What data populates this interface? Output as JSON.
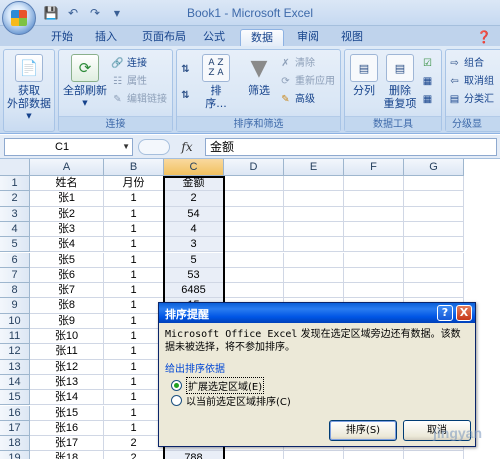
{
  "window": {
    "title": "Book1 - Microsoft Excel"
  },
  "qat": {
    "icons": [
      "save-icon",
      "undo-icon",
      "redo-icon"
    ]
  },
  "tabs": [
    {
      "label": "开始",
      "active": false
    },
    {
      "label": "插入",
      "active": false
    },
    {
      "label": "页面布局",
      "active": false
    },
    {
      "label": "公式",
      "active": false
    },
    {
      "label": "数据",
      "active": true
    },
    {
      "label": "审阅",
      "active": false
    },
    {
      "label": "视图",
      "active": false
    }
  ],
  "ribbon": {
    "get_external": {
      "label": "获取外部数据",
      "line1": "获取",
      "line2": "外部数据"
    },
    "connections": {
      "group_label": "连接",
      "refresh_line1": "全部刷新",
      "connect": "连接",
      "properties": "属性",
      "edit_links": "编辑链接"
    },
    "sort_filter": {
      "group_label": "排序和筛选",
      "sort": "排序...",
      "filter": "筛选",
      "clear": "清除",
      "reapply": "重新应用",
      "advanced": "高级",
      "az": "A Z",
      "za": "Z A"
    },
    "data_tools": {
      "group_label": "数据工具",
      "split": "分列",
      "remove_line1": "删除",
      "remove_line2": "重复项"
    },
    "outline": {
      "group_label": "分级显",
      "group": "组合",
      "ungroup": "取消组",
      "subtotal": "分类汇"
    }
  },
  "formula_bar": {
    "name_box": "C1",
    "fx": "fx",
    "value": "金额"
  },
  "columns": [
    "A",
    "B",
    "C",
    "D",
    "E",
    "F",
    "G"
  ],
  "rows": [
    {
      "n": "1",
      "a": "姓名",
      "b": "月份",
      "c": "金额"
    },
    {
      "n": "2",
      "a": "张1",
      "b": "1",
      "c": "2"
    },
    {
      "n": "3",
      "a": "张2",
      "b": "1",
      "c": "54"
    },
    {
      "n": "4",
      "a": "张3",
      "b": "1",
      "c": "4"
    },
    {
      "n": "5",
      "a": "张4",
      "b": "1",
      "c": "3"
    },
    {
      "n": "6",
      "a": "张5",
      "b": "1",
      "c": "5"
    },
    {
      "n": "7",
      "a": "张6",
      "b": "1",
      "c": "53"
    },
    {
      "n": "8",
      "a": "张7",
      "b": "1",
      "c": "6485"
    },
    {
      "n": "9",
      "a": "张8",
      "b": "1",
      "c": "15"
    },
    {
      "n": "10",
      "a": "张9",
      "b": "1",
      "c": ""
    },
    {
      "n": "11",
      "a": "张10",
      "b": "1",
      "c": ""
    },
    {
      "n": "12",
      "a": "张11",
      "b": "1",
      "c": ""
    },
    {
      "n": "13",
      "a": "张12",
      "b": "1",
      "c": ""
    },
    {
      "n": "14",
      "a": "张13",
      "b": "1",
      "c": ""
    },
    {
      "n": "15",
      "a": "张14",
      "b": "1",
      "c": ""
    },
    {
      "n": "16",
      "a": "张15",
      "b": "1",
      "c": ""
    },
    {
      "n": "17",
      "a": "张16",
      "b": "1",
      "c": ""
    },
    {
      "n": "18",
      "a": "张17",
      "b": "2",
      "c": "87"
    },
    {
      "n": "19",
      "a": "张18",
      "b": "2",
      "c": "788"
    }
  ],
  "dialog": {
    "title": "排序提醒",
    "message_prefix": "Microsoft Office Excel",
    "message_rest": " 发现在选定区域旁边还有数据。该数据未被选择，将不参加排序。",
    "group_label": "给出排序依据",
    "option1": "扩展选定区域(E)",
    "option2": "以当前选定区域排序(C)",
    "sort_button": "排序(S)",
    "cancel_button": "取消",
    "help": "?",
    "close": "X"
  },
  "watermark": "jingyan"
}
